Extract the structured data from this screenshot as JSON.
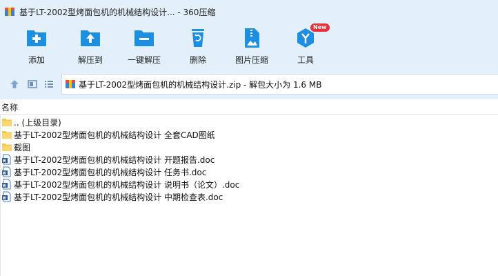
{
  "window": {
    "title": "基于LT-2002型烤面包机的机械结构设计... - 360压缩"
  },
  "toolbar": {
    "items": [
      {
        "label": "添加",
        "icon": "add-icon"
      },
      {
        "label": "解压到",
        "icon": "extract-to-icon"
      },
      {
        "label": "一键解压",
        "icon": "one-click-extract-icon"
      },
      {
        "label": "删除",
        "icon": "delete-icon"
      },
      {
        "label": "图片压缩",
        "icon": "image-compress-icon"
      },
      {
        "label": "工具",
        "icon": "tools-icon",
        "badge": "New"
      }
    ]
  },
  "address": {
    "path": "基于LT-2002型烤面包机的机械结构设计.zip - 解包大小为 1.6 MB"
  },
  "list": {
    "header": "名称",
    "rows": [
      {
        "name": ".. (上级目录)",
        "type": "folder"
      },
      {
        "name": "基于LT-2002型烤面包机的机械结构设计 全套CAD图纸",
        "type": "folder"
      },
      {
        "name": "截图",
        "type": "folder"
      },
      {
        "name": "基于LT-2002型烤面包机的机械结构设计 开题报告.doc",
        "type": "doc"
      },
      {
        "name": "基于LT-2002型烤面包机的机械结构设计 任务书.doc",
        "type": "doc"
      },
      {
        "name": "基于LT-2002型烤面包机的机械结构设计 说明书（论文）.doc",
        "type": "doc"
      },
      {
        "name": "基于LT-2002型烤面包机的机械结构设计 中期检查表.doc",
        "type": "doc"
      }
    ]
  },
  "colors": {
    "toolbar_bg": "#e3f0fb",
    "icon_blue": "#1d8fe1",
    "folder_yellow": "#f5c84c",
    "badge_red": "#e8303a"
  }
}
